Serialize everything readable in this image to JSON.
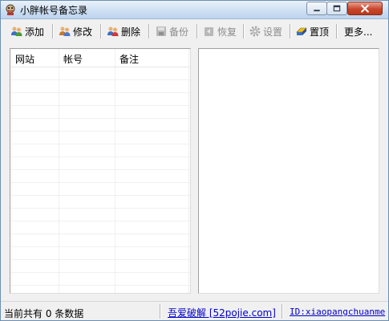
{
  "window": {
    "title": "小胖帐号备忘录"
  },
  "toolbar": {
    "add": "添加",
    "edit": "修改",
    "delete": "删除",
    "backup": "备份",
    "restore": "恢复",
    "settings": "设置",
    "pin": "置顶",
    "more": "更多..."
  },
  "table": {
    "columns": [
      "网站",
      "帐号",
      "备注"
    ],
    "rows": []
  },
  "status": {
    "count_text": "当前共有 0 条数据",
    "link1": "吾爱破解 [52pojie.com]",
    "link2": "ID:xiaopangchuanme"
  },
  "colors": {
    "title_gradient_top": "#eaf2fb",
    "title_gradient_bottom": "#bcd3ee",
    "link": "#0000cc",
    "disabled_text": "#8c8c8c"
  }
}
